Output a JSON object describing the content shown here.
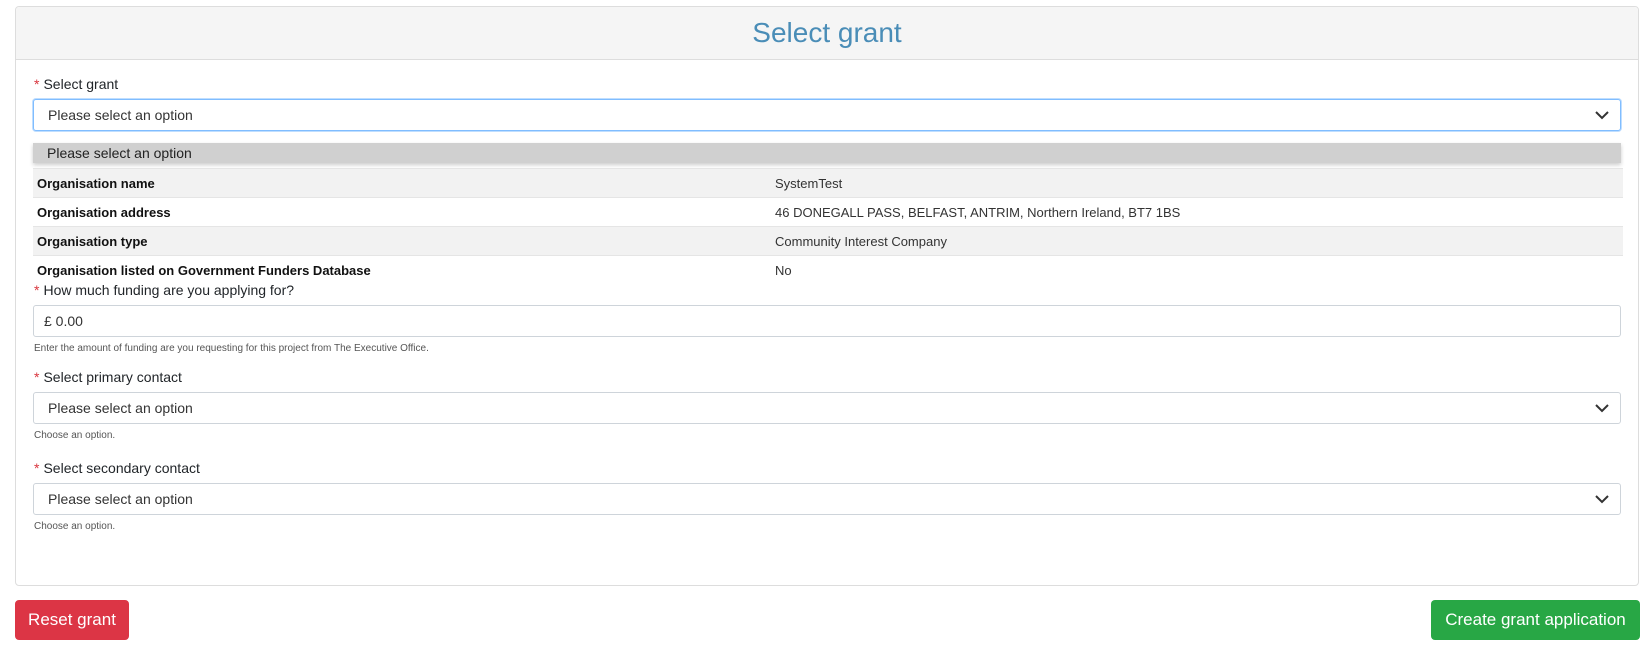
{
  "panel": {
    "title": "Select grant"
  },
  "grant_select": {
    "label": "Select grant",
    "value": "Please select an option",
    "options": [
      "Please select an option"
    ]
  },
  "organisation": [
    {
      "key": "Organisation name",
      "value": "SystemTest"
    },
    {
      "key": "Organisation address",
      "value": "46 DONEGALL PASS, BELFAST, ANTRIM, Northern Ireland, BT7 1BS"
    },
    {
      "key": "Organisation type",
      "value": "Community Interest Company"
    },
    {
      "key": "Organisation listed on Government Funders Database",
      "value": "No"
    }
  ],
  "funding": {
    "label": "How much funding are you applying for?",
    "value": "£ 0.00",
    "help": "Enter the amount of funding are you requesting for this project from The Executive Office."
  },
  "primary_contact": {
    "label": "Select primary contact",
    "value": "Please select an option",
    "help": "Choose an option."
  },
  "secondary_contact": {
    "label": "Select secondary contact",
    "value": "Please select an option",
    "help": "Choose an option."
  },
  "actions": {
    "reset_label": "Reset grant",
    "create_label": "Create grant application"
  },
  "colors": {
    "title": "#4a8db7",
    "required": "#d9363e",
    "reset": "#dc3545",
    "create": "#28a745"
  }
}
